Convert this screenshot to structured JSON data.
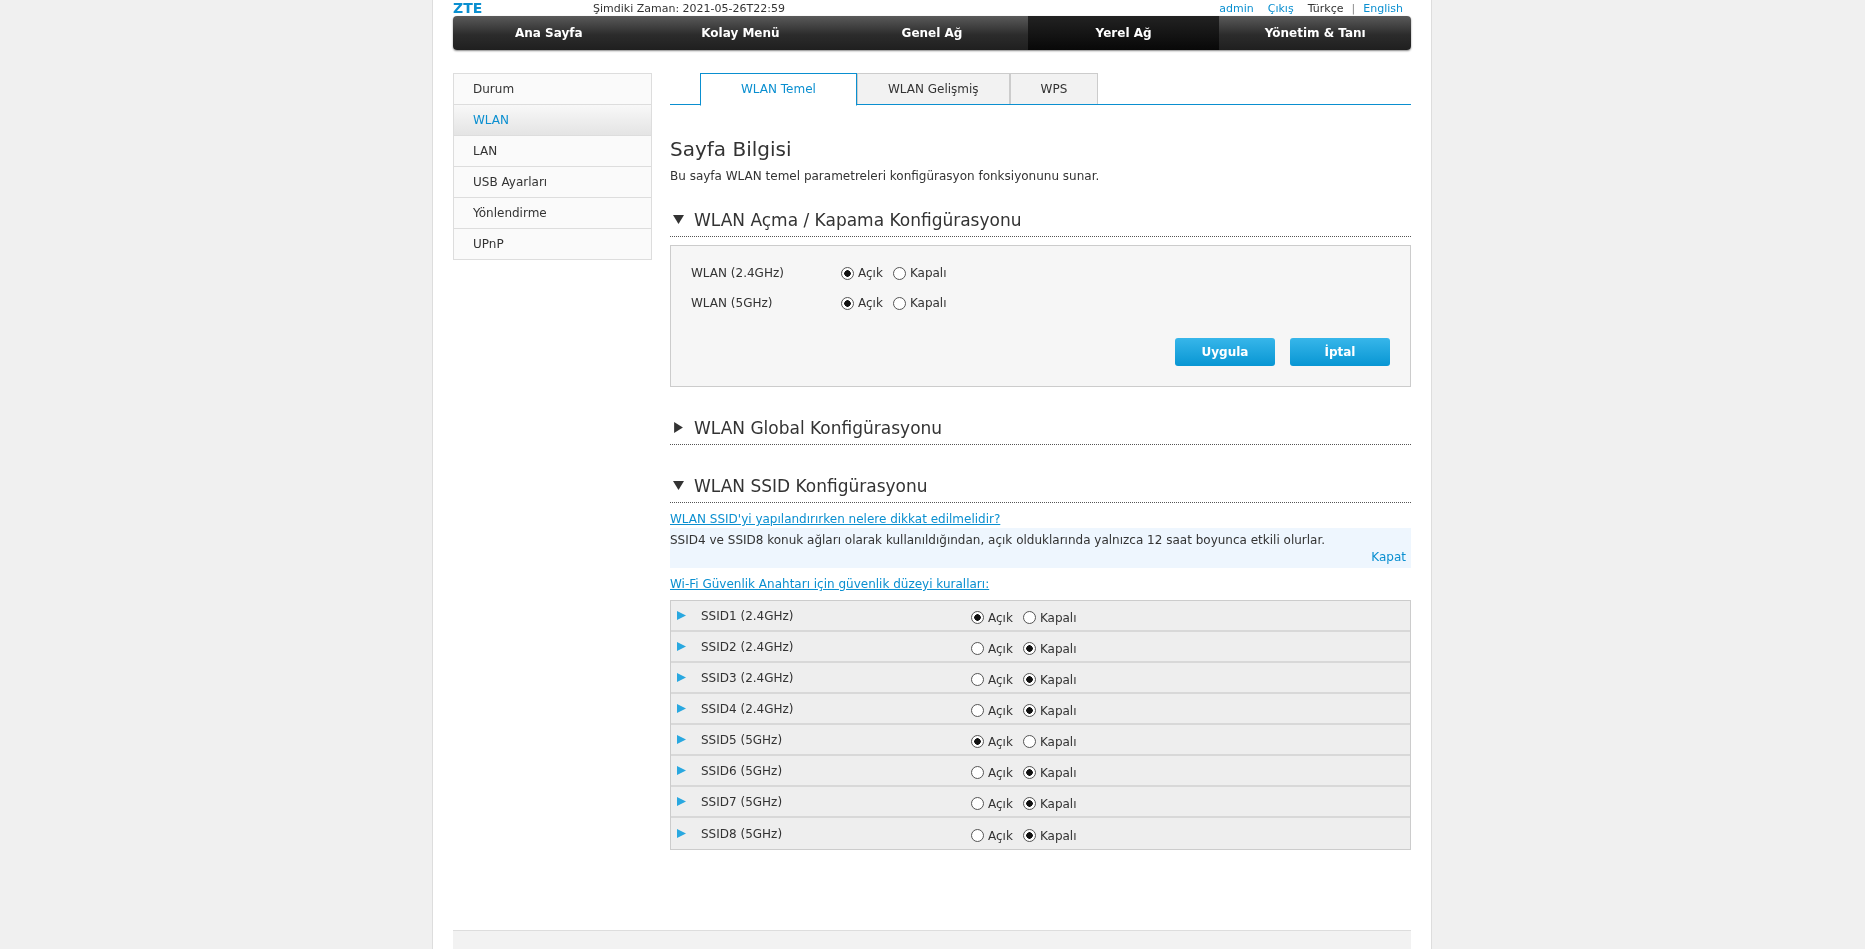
{
  "header": {
    "logo": "ZTE",
    "time": "Şimdiki Zaman: 2021-05-26T22:59",
    "user_links": [
      "admin",
      "Çıkış"
    ],
    "separator": "|",
    "languages": [
      {
        "label": "Türkçe",
        "selected": true
      },
      {
        "label": "English",
        "selected": false
      }
    ]
  },
  "nav": [
    {
      "label": "Ana Sayfa",
      "selected": false
    },
    {
      "label": "Kolay Menü",
      "selected": false
    },
    {
      "label": "Genel Ağ",
      "selected": false
    },
    {
      "label": "Yerel Ağ",
      "selected": true
    },
    {
      "label": "Yönetim & Tanı",
      "selected": false
    }
  ],
  "sidebar": [
    {
      "label": "Durum",
      "selected": false
    },
    {
      "label": "WLAN",
      "selected": true
    },
    {
      "label": "LAN",
      "selected": false
    },
    {
      "label": "USB Ayarları",
      "selected": false
    },
    {
      "label": "Yönlendirme",
      "selected": false
    },
    {
      "label": "UPnP",
      "selected": false
    }
  ],
  "tabs": [
    {
      "label": "WLAN Temel",
      "selected": true
    },
    {
      "label": "WLAN Gelişmiş",
      "selected": false
    },
    {
      "label": "WPS",
      "selected": false
    }
  ],
  "page_info": {
    "title": "Sayfa Bilgisi",
    "description": "Bu sayfa WLAN temel parametreleri konfigürasyon fonksiyonunu sunar."
  },
  "sections": [
    {
      "kind": "onoff",
      "title": "WLAN Açma / Kapama Konfigürasyonu",
      "expanded": true,
      "rows": [
        {
          "label": "WLAN (2.4GHz)",
          "options": [
            {
              "label": "Açık",
              "selected": true
            },
            {
              "label": "Kapalı",
              "selected": false
            }
          ]
        },
        {
          "label": "WLAN (5GHz)",
          "options": [
            {
              "label": "Açık",
              "selected": true
            },
            {
              "label": "Kapalı",
              "selected": false
            }
          ]
        }
      ],
      "buttons": [
        "Uygula",
        "İptal"
      ]
    },
    {
      "title": "WLAN Global Konfigürasyonu",
      "expanded": false
    },
    {
      "kind": "ssid",
      "title": "WLAN SSID Konfigürasyonu",
      "expanded": true,
      "help_link": "WLAN SSID'yi yapılandırırken nelere dikkat edilmelidir?",
      "notice": {
        "text": "SSID4 ve SSID8 konuk ağları olarak kullanıldığından, açık olduklarında yalnızca 12 saat boyunca etkili olurlar.",
        "close": "Kapat"
      },
      "rules_link": "Wi-Fi Güvenlik Anahtarı için güvenlik düzeyi kuralları:",
      "rows": [
        {
          "label": "SSID1 (2.4GHz)",
          "expanded": false,
          "options": [
            {
              "label": "Açık",
              "selected": true
            },
            {
              "label": "Kapalı",
              "selected": false
            }
          ]
        },
        {
          "label": "SSID2 (2.4GHz)",
          "expanded": false,
          "options": [
            {
              "label": "Açık",
              "selected": false
            },
            {
              "label": "Kapalı",
              "selected": true
            }
          ]
        },
        {
          "label": "SSID3 (2.4GHz)",
          "expanded": false,
          "options": [
            {
              "label": "Açık",
              "selected": false
            },
            {
              "label": "Kapalı",
              "selected": true
            }
          ]
        },
        {
          "label": "SSID4 (2.4GHz)",
          "expanded": false,
          "options": [
            {
              "label": "Açık",
              "selected": false
            },
            {
              "label": "Kapalı",
              "selected": true
            }
          ]
        },
        {
          "label": "SSID5 (5GHz)",
          "expanded": false,
          "options": [
            {
              "label": "Açık",
              "selected": true
            },
            {
              "label": "Kapalı",
              "selected": false
            }
          ]
        },
        {
          "label": "SSID6 (5GHz)",
          "expanded": false,
          "options": [
            {
              "label": "Açık",
              "selected": false
            },
            {
              "label": "Kapalı",
              "selected": true
            }
          ]
        },
        {
          "label": "SSID7 (5GHz)",
          "expanded": false,
          "options": [
            {
              "label": "Açık",
              "selected": false
            },
            {
              "label": "Kapalı",
              "selected": true
            }
          ]
        },
        {
          "label": "SSID8 (5GHz)",
          "expanded": false,
          "options": [
            {
              "label": "Açık",
              "selected": false
            },
            {
              "label": "Kapalı",
              "selected": true
            }
          ]
        }
      ]
    }
  ]
}
